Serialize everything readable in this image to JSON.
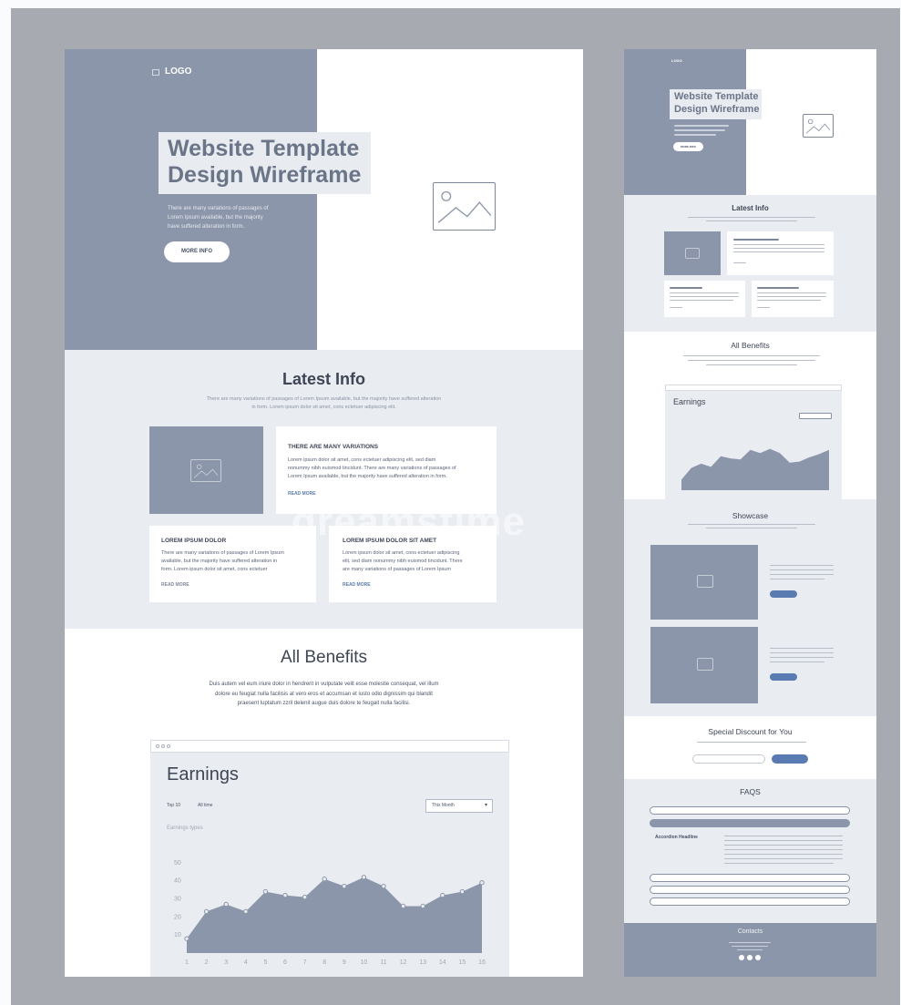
{
  "left": {
    "logo": "LOGO",
    "hero": {
      "title_line1": "Website Template",
      "title_line2": "Design Wireframe",
      "desc": [
        "There are many variations of passages of",
        "Lorem Ipsum available, but the majority",
        "have suffered alteration in form."
      ],
      "button": "MORE INFO"
    },
    "latest": {
      "title": "Latest Info",
      "desc": [
        "There are many variations of passages of Lorem Ipsum available, but the majority have suffered alteration",
        "in form. Lorem ipsum dolor sit amet, cons ectetuer adipiscing elit."
      ],
      "feature": {
        "heading": "THERE ARE MANY VARIATIONS",
        "body": [
          "Lorem ipsum dolor sit amet, cons ectetuer adipiscing elit, sed diam",
          "nonummy nibh euismod tincidunt. There are many variations of passages of",
          "Lorem Ipsum available, but the majority have suffered alteration in form."
        ],
        "link": "READ MORE"
      },
      "card1": {
        "heading": "LOREM IPSUM DOLOR",
        "body": [
          "There are many variations of passages of Lorem Ipsum",
          "available, but the majority have suffered alteration in",
          "form. Lorem ipsum dolor sit amet, cons ectetuer"
        ],
        "link": "READ MORE"
      },
      "card2": {
        "heading": "LOREM IPSUM DOLOR SIT AMET",
        "body": [
          "Lorem ipsum dolor sit amet, cons ectetuer adipiscing",
          "elit, sed diam nonummy nibh euismod tincidunt. There",
          "are many variations of passages of Lorem Ipsum"
        ],
        "link": "READ MORE"
      }
    },
    "benefits": {
      "title": "All Benefits",
      "desc": [
        "Duis autem vel eum iriure dolor in hendrerit in vulputate velit esse molestie consequat, vel illum",
        "dolore eu feugiat nulla facilisis at vero eros et accumsan et iusto odio dignissim qui blandit",
        "praesent luptatum zzril delenit augue duis dolore te feugait nulla facilisi."
      ]
    },
    "earnings": {
      "title": "Earnings",
      "filter1": "Top 10",
      "filter2": "All time",
      "dropdown": "This Month",
      "series_label": "Earnings types"
    }
  },
  "right": {
    "logo": "LOGO",
    "hero": {
      "title_line1": "Website Template",
      "title_line2": "Design Wireframe",
      "button": "MORE INFO"
    },
    "latest_title": "Latest Info",
    "benefits_title": "All Benefits",
    "earnings_title": "Earnings",
    "showcase_title": "Showcase",
    "discount_title": "Special Discount for You",
    "faqs_title": "FAQS",
    "accordion_headline": "Accordion Headline",
    "contacts_title": "Contacts"
  },
  "watermark": "dreamstime",
  "colors": {
    "background_band": "#a7abb1",
    "grey_block": "#8c96aa",
    "light_section": "#e9ecf1",
    "accent_blue": "#5a7bb1"
  },
  "chart_data": [
    {
      "type": "area",
      "title": "Earnings",
      "x": [
        1,
        2,
        3,
        4,
        5,
        6,
        7,
        8,
        9,
        10,
        11,
        12,
        13,
        14,
        15,
        16
      ],
      "y": [
        8,
        23,
        27,
        23,
        34,
        32,
        31,
        41,
        37,
        42,
        37,
        26,
        26,
        32,
        34,
        39
      ],
      "yticks": [
        10,
        20,
        30,
        40,
        50
      ],
      "ylim": [
        0,
        55
      ],
      "grid": false
    },
    {
      "type": "area",
      "title": "Earnings",
      "x": [
        1,
        2,
        3,
        4,
        5,
        6,
        7,
        8,
        9,
        10,
        11,
        12,
        13,
        14,
        15,
        16
      ],
      "y": [
        10,
        21,
        25,
        22,
        32,
        30,
        29,
        38,
        35,
        39,
        35,
        26,
        27,
        31,
        34,
        38
      ],
      "yticks": [
        10,
        20,
        30,
        40,
        50
      ],
      "ylim": [
        0,
        55
      ],
      "grid": false
    }
  ]
}
